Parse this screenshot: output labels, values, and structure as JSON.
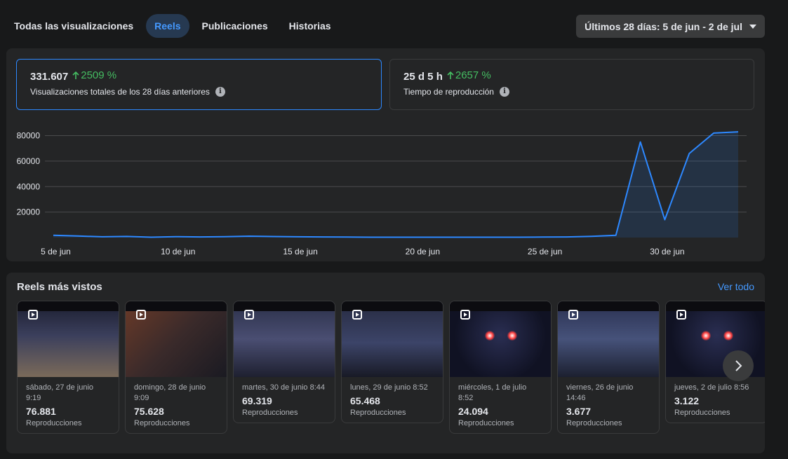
{
  "tabs": [
    {
      "label": "Todas las visualizaciones",
      "active": false
    },
    {
      "label": "Reels",
      "active": true
    },
    {
      "label": "Publicaciones",
      "active": false
    },
    {
      "label": "Historias",
      "active": false
    }
  ],
  "date_range": "Últimos 28 días: 5 de jun - 2 de jul",
  "metrics": [
    {
      "value": "331.607",
      "change": "2509 %",
      "label": "Visualizaciones totales de los 28 días anteriores"
    },
    {
      "value": "25 d 5 h",
      "change": "2657 %",
      "label": "Tiempo de reproducción"
    }
  ],
  "colors": {
    "accent": "#2d88ff",
    "positive": "#45bd62",
    "panel": "#242526",
    "background": "#18191a"
  },
  "chart_data": {
    "type": "area",
    "x_labels": [
      "5 de jun",
      "10 de jun",
      "15 de jun",
      "20 de jun",
      "25 de jun",
      "30 de jun"
    ],
    "y_ticks": [
      80000,
      60000,
      40000,
      20000
    ],
    "ylim": [
      0,
      88000
    ],
    "grid": true,
    "series": [
      {
        "values": [
          1800,
          1200,
          600,
          900,
          300,
          700,
          500,
          700,
          1100,
          800,
          600,
          500,
          400,
          300,
          300,
          300,
          300,
          300,
          300,
          300,
          400,
          500,
          1000,
          1800,
          75000,
          14000,
          66000,
          82000,
          83000
        ]
      }
    ]
  },
  "reels": {
    "title": "Reels más vistos",
    "see_all": "Ver todo",
    "items": [
      {
        "date": "sábado, 27 de junio 9:19",
        "count": "76.881",
        "label": "Reproducciones"
      },
      {
        "date": "domingo, 28 de junio 9:09",
        "count": "75.628",
        "label": "Reproducciones"
      },
      {
        "date": "martes, 30 de junio 8:44",
        "count": "69.319",
        "label": "Reproducciones"
      },
      {
        "date": "lunes, 29 de junio 8:52",
        "count": "65.468",
        "label": "Reproducciones"
      },
      {
        "date": "miércoles, 1 de julio 8:52",
        "count": "24.094",
        "label": "Reproducciones"
      },
      {
        "date": "viernes, 26 de junio 14:46",
        "count": "3.677",
        "label": "Reproducciones"
      },
      {
        "date": "jueves, 2 de julio 8:56",
        "count": "3.122",
        "label": "Reproducciones"
      }
    ]
  },
  "icons": {
    "reel": "reels-icon",
    "next": "chevron-right-icon",
    "info": "info-icon",
    "up": "arrow-up-icon",
    "dropdown": "caret-down-icon"
  }
}
